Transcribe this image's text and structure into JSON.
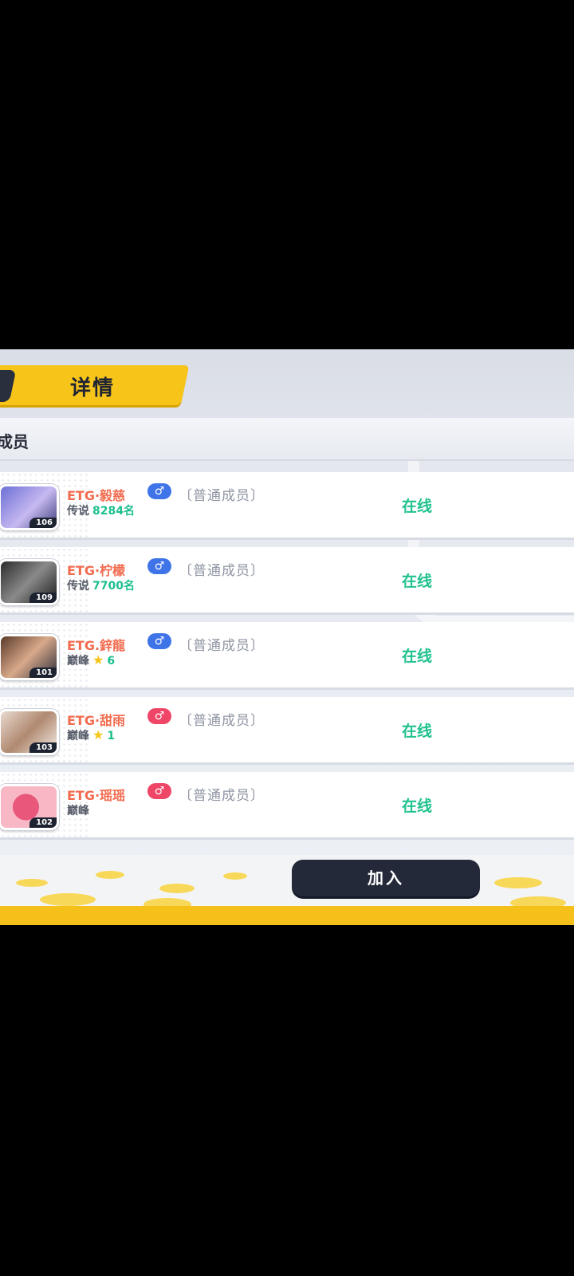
{
  "header": {
    "title": "详情"
  },
  "section": {
    "title": "成员"
  },
  "members": [
    {
      "level": "106",
      "name": "ETG·毅慈",
      "gender": "male",
      "gender_symbol": "♂",
      "role": "〔普通成员〕",
      "rank": "传说",
      "rank_value": "8284名",
      "stars": "",
      "status": "在线"
    },
    {
      "level": "109",
      "name": "ETG·柠檬",
      "gender": "male",
      "gender_symbol": "♂",
      "role": "〔普通成员〕",
      "rank": "传说",
      "rank_value": "7700名",
      "stars": "",
      "status": "在线"
    },
    {
      "level": "101",
      "name": "ETG.鋅龍",
      "gender": "male",
      "gender_symbol": "♂",
      "role": "〔普通成员〕",
      "rank": "巅峰",
      "rank_value": "6",
      "stars": "★",
      "status": "在线"
    },
    {
      "level": "103",
      "name": "ETG·甜雨",
      "gender": "female",
      "gender_symbol": "♂",
      "role": "〔普通成员〕",
      "rank": "巅峰",
      "rank_value": "1",
      "stars": "★",
      "status": "在线"
    },
    {
      "level": "102",
      "name": "ETG·瑶瑶",
      "gender": "female",
      "gender_symbol": "♂",
      "role": "〔普通成员〕",
      "rank": "巅峰",
      "rank_value": "",
      "stars": "",
      "status": "在线"
    }
  ],
  "join_button": {
    "label": "加入"
  },
  "colors": {
    "accent_yellow": "#f7c51a",
    "online_green": "#21c28f",
    "name_orange": "#f26b4f",
    "male_blue": "#3f74e8",
    "female_pink": "#ef4668",
    "button_dark": "#24293a"
  },
  "icons": {
    "gender": "gender-icon",
    "star": "star-icon"
  }
}
